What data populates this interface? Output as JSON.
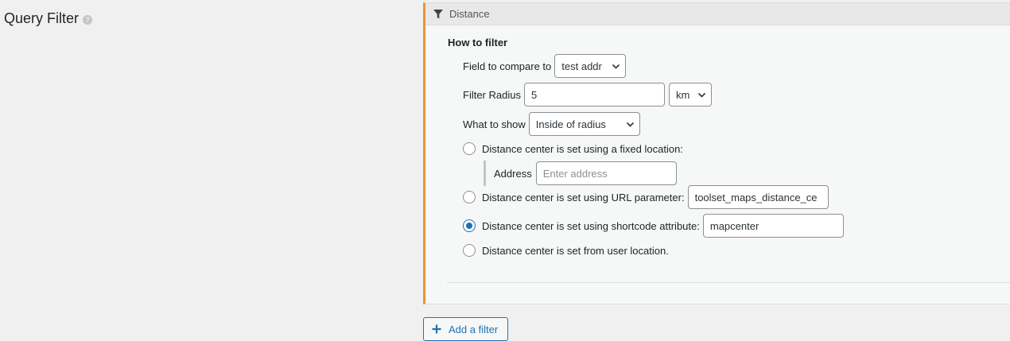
{
  "section": {
    "title": "Query Filter",
    "help_glyph": "?"
  },
  "panel": {
    "title": "Distance",
    "how_to_filter": "How to filter",
    "field_compare": {
      "label": "Field to compare to",
      "value": "test addr"
    },
    "radius": {
      "label": "Filter Radius",
      "value": "5",
      "unit": "km"
    },
    "what_to_show": {
      "label": "What to show",
      "value": "Inside of radius"
    },
    "options": [
      {
        "label": "Distance center is set using a fixed location:",
        "checked": false
      },
      {
        "label": "Distance center is set using URL parameter:",
        "checked": false,
        "value": "toolset_maps_distance_ce"
      },
      {
        "label": "Distance center is set using shortcode attribute:",
        "checked": true,
        "value": "mapcenter"
      },
      {
        "label": "Distance center is set from user location.",
        "checked": false
      }
    ],
    "address": {
      "label": "Address",
      "placeholder": "Enter address"
    }
  },
  "add_filter": {
    "label": "Add a filter"
  },
  "colors": {
    "accent_orange": "#f0922e",
    "link_blue": "#2271b1",
    "background": "#f0f0f1"
  },
  "icons": {
    "filter": "funnel-icon",
    "help": "question-circle-icon",
    "add": "plus-icon",
    "dropdown": "chevron-down-icon"
  }
}
